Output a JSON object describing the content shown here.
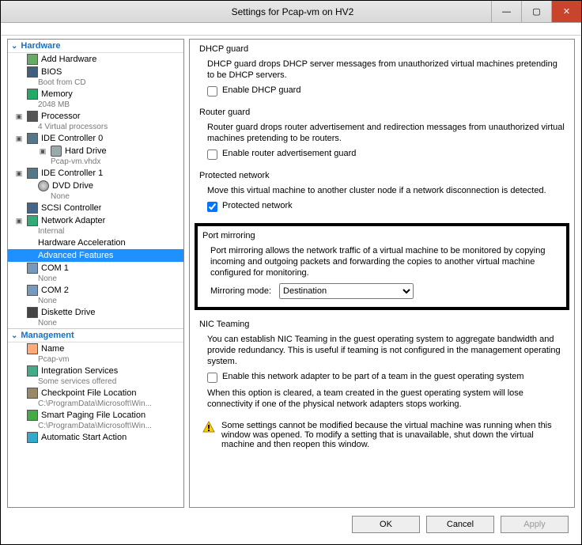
{
  "window": {
    "title": "Settings for Pcap-vm on HV2"
  },
  "sections": {
    "hardware": "Hardware",
    "management": "Management"
  },
  "tree": {
    "add_hw": "Add Hardware",
    "bios": "BIOS",
    "bios_sub": "Boot from CD",
    "memory": "Memory",
    "memory_sub": "2048 MB",
    "processor": "Processor",
    "processor_sub": "4 Virtual processors",
    "ide0": "IDE Controller 0",
    "hd": "Hard Drive",
    "hd_sub": "Pcap-vm.vhdx",
    "ide1": "IDE Controller 1",
    "dvd": "DVD Drive",
    "dvd_sub": "None",
    "scsi": "SCSI Controller",
    "net": "Network Adapter",
    "net_sub": "Internal",
    "hwaccel": "Hardware Acceleration",
    "advfeat": "Advanced Features",
    "com1": "COM 1",
    "com1_sub": "None",
    "com2": "COM 2",
    "com2_sub": "None",
    "diskette": "Diskette Drive",
    "diskette_sub": "None",
    "name": "Name",
    "name_sub": "Pcap-vm",
    "integ": "Integration Services",
    "integ_sub": "Some services offered",
    "chk": "Checkpoint File Location",
    "chk_sub": "C:\\ProgramData\\Microsoft\\Win...",
    "smart": "Smart Paging File Location",
    "smart_sub": "C:\\ProgramData\\Microsoft\\Win...",
    "auto": "Automatic Start Action"
  },
  "panel": {
    "dhcp": {
      "title": "DHCP guard",
      "desc": "DHCP guard drops DHCP server messages from unauthorized virtual machines pretending to be DHCP servers.",
      "chk": "Enable DHCP guard"
    },
    "router": {
      "title": "Router guard",
      "desc": "Router guard drops router advertisement and redirection messages from unauthorized virtual machines pretending to be routers.",
      "chk": "Enable router advertisement guard"
    },
    "protected": {
      "title": "Protected network",
      "desc": "Move this virtual machine to another cluster node if a network disconnection is detected.",
      "chk": "Protected network"
    },
    "port": {
      "title": "Port mirroring",
      "desc": "Port mirroring allows the network traffic of a virtual machine to be monitored by copying incoming and outgoing packets and forwarding the copies to another virtual machine configured for monitoring.",
      "lbl": "Mirroring mode:",
      "value": "Destination"
    },
    "nic": {
      "title": "NIC Teaming",
      "desc": "You can establish NIC Teaming in the guest operating system to aggregate bandwidth and provide redundancy. This is useful if teaming is not configured in the management operating system.",
      "chk": "Enable this network adapter to be part of a team in the guest operating system",
      "desc2": "When this option is cleared, a team created in the guest operating system will lose connectivity if one of the physical network adapters stops working."
    },
    "warn": "Some settings cannot be modified because the virtual machine was running when this window was opened. To modify a setting that is unavailable, shut down the virtual machine and then reopen this window."
  },
  "buttons": {
    "ok": "OK",
    "cancel": "Cancel",
    "apply": "Apply"
  }
}
